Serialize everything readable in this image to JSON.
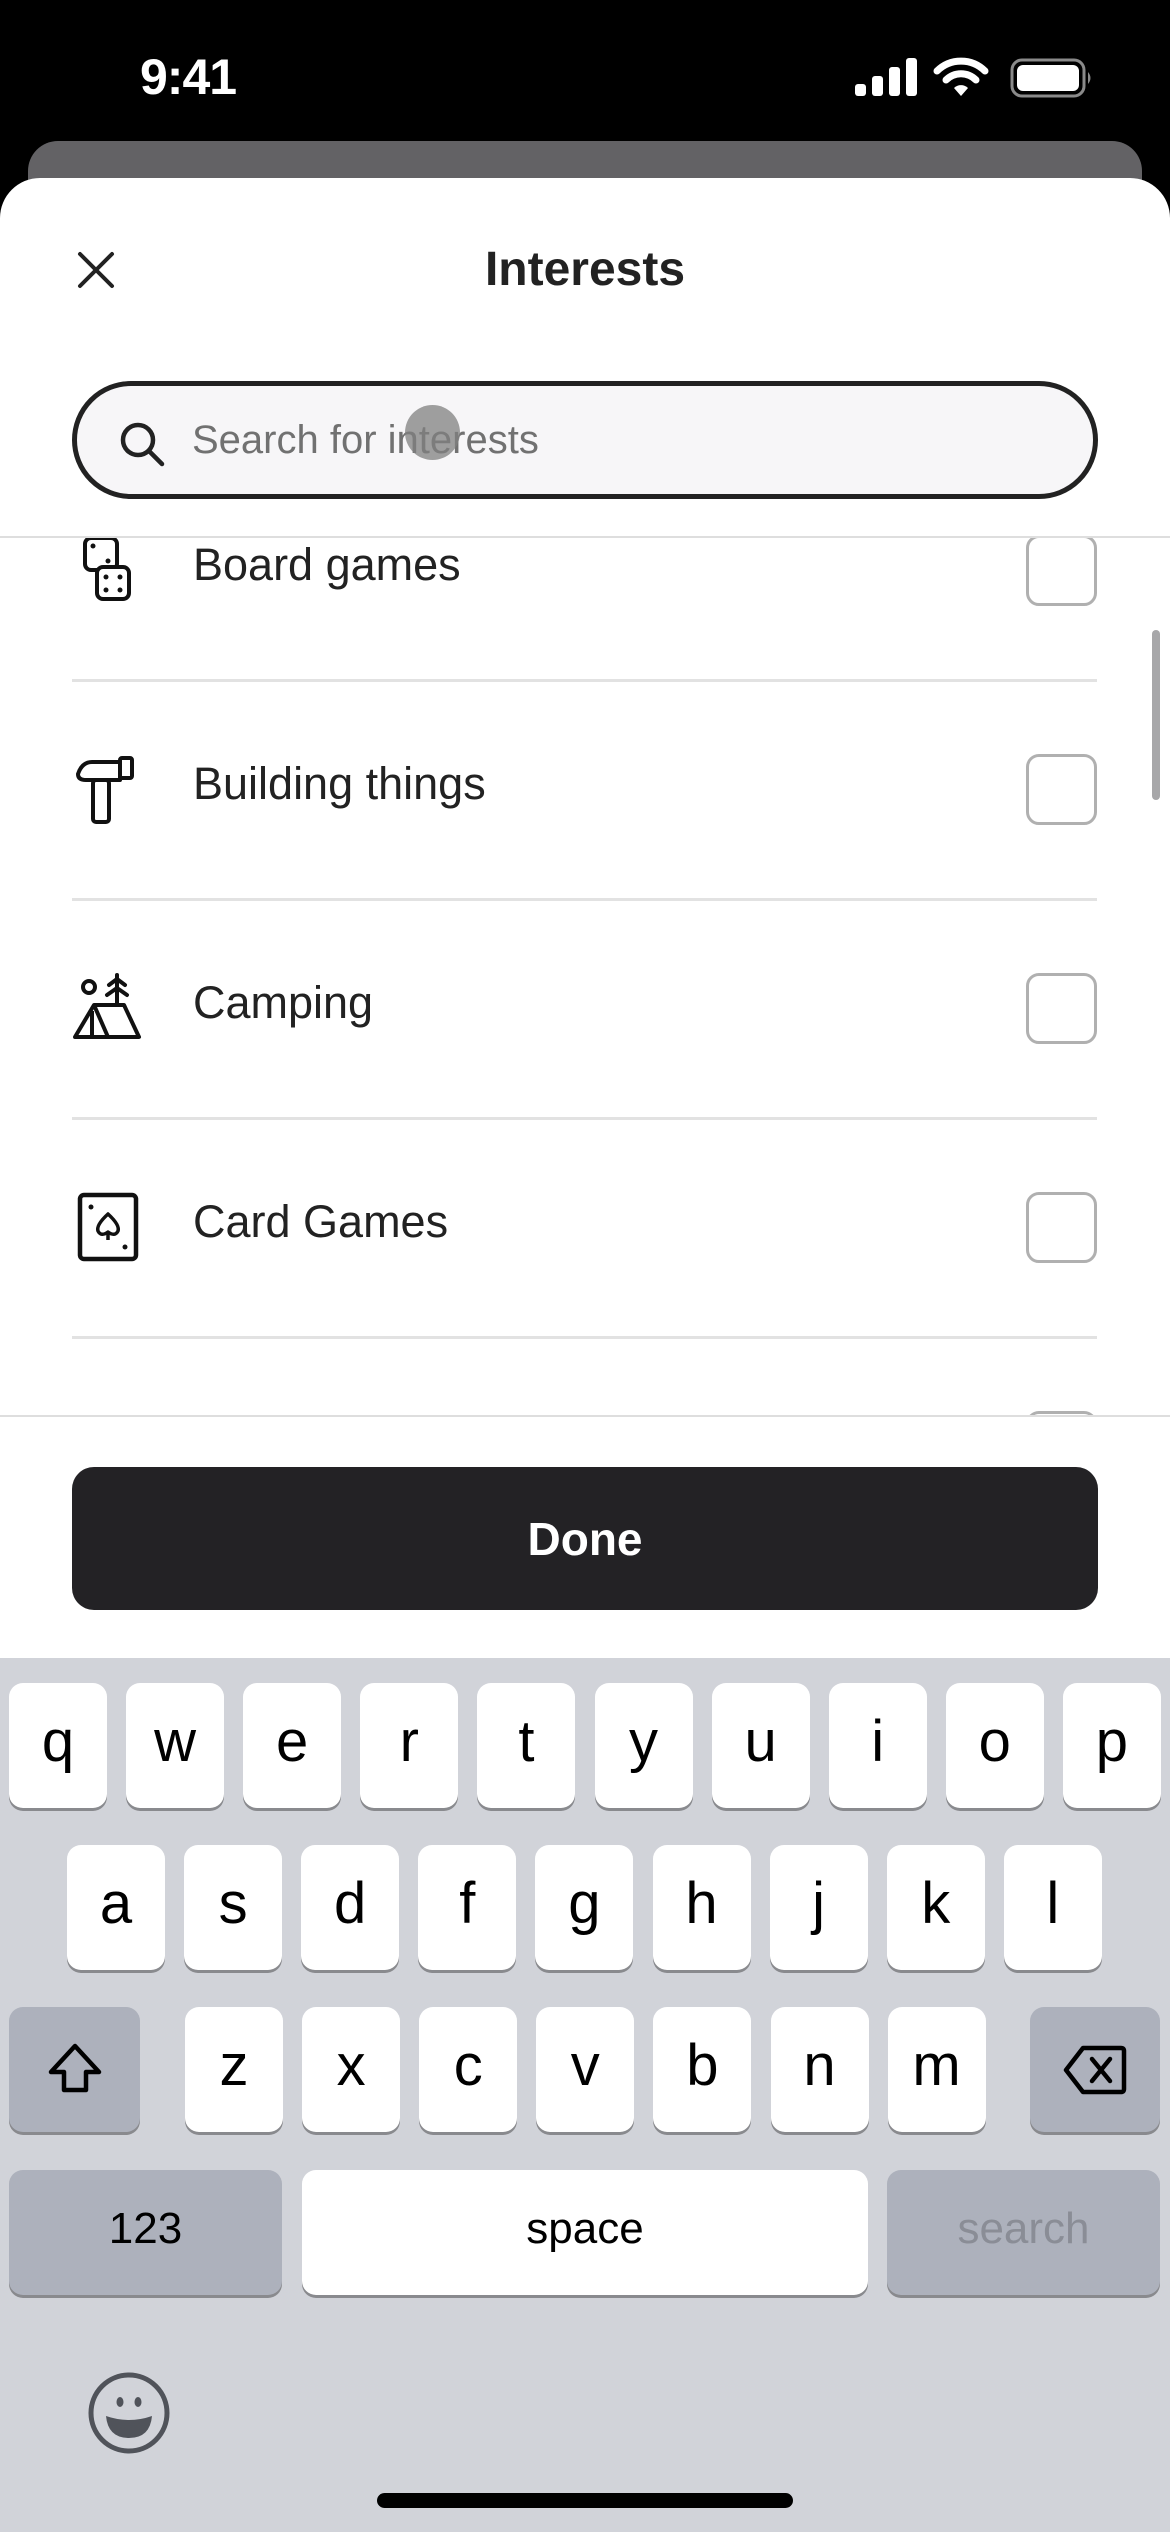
{
  "status_bar": {
    "time": "9:41",
    "icons": [
      "cellular-signal-icon",
      "wifi-icon",
      "battery-icon"
    ]
  },
  "header": {
    "title": "Interests",
    "close_icon": "close-icon"
  },
  "search": {
    "placeholder": "Search for interests",
    "value": "",
    "icon": "search-icon"
  },
  "interests": [
    {
      "label": "Board games",
      "icon": "dice-icon",
      "checked": false
    },
    {
      "label": "Building things",
      "icon": "hammer-icon",
      "checked": false
    },
    {
      "label": "Camping",
      "icon": "tent-icon",
      "checked": false
    },
    {
      "label": "Card Games",
      "icon": "playing-card-icon",
      "checked": false
    },
    {
      "label": "",
      "icon": "",
      "checked": false
    }
  ],
  "footer": {
    "done_label": "Done"
  },
  "keyboard": {
    "row1": [
      "q",
      "w",
      "e",
      "r",
      "t",
      "y",
      "u",
      "i",
      "o",
      "p"
    ],
    "row2": [
      "a",
      "s",
      "d",
      "f",
      "g",
      "h",
      "j",
      "k",
      "l"
    ],
    "row3": [
      "z",
      "x",
      "c",
      "v",
      "b",
      "n",
      "m"
    ],
    "numbers_label": "123",
    "space_label": "space",
    "return_label": "search",
    "shift_icon": "shift-icon",
    "delete_icon": "backspace-icon",
    "emoji_icon": "emoji-icon"
  },
  "colors": {
    "primary_button": "#232225",
    "text": "#222222",
    "keyboard_bg": "#d1d3d9",
    "key_gray": "#adb1bc",
    "checkbox_border": "#b0b0b0"
  }
}
